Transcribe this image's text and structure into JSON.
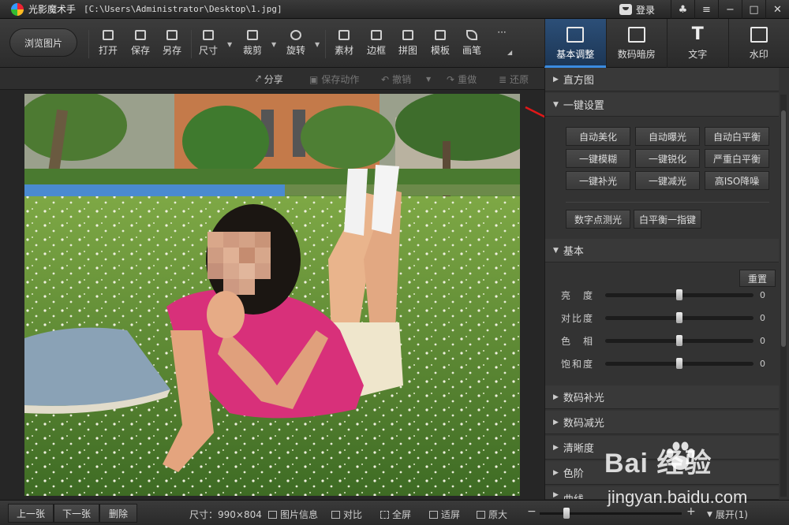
{
  "titlebar": {
    "app_name": "光影魔术手",
    "file_path": "[C:\\Users\\Administrator\\Desktop\\1.jpg]",
    "login": "登录",
    "buttons": [
      "skin-icon",
      "menu-icon",
      "minimize-icon",
      "maximize-icon",
      "close-icon"
    ]
  },
  "toolbar": {
    "browse": "浏览图片",
    "tools": [
      {
        "label": "打开",
        "icon": "open-icon"
      },
      {
        "label": "保存",
        "icon": "save-icon"
      },
      {
        "label": "另存",
        "icon": "save-as-icon"
      },
      {
        "label": "尺寸",
        "icon": "resize-icon"
      },
      {
        "label": "裁剪",
        "icon": "crop-icon"
      },
      {
        "label": "旋转",
        "icon": "rotate-icon"
      },
      {
        "label": "素材",
        "icon": "material-icon"
      },
      {
        "label": "边框",
        "icon": "frame-icon"
      },
      {
        "label": "拼图",
        "icon": "collage-icon"
      },
      {
        "label": "模板",
        "icon": "template-icon"
      },
      {
        "label": "画笔",
        "icon": "brush-icon"
      },
      {
        "label": "···",
        "icon": "more-icon"
      }
    ]
  },
  "mode_tabs": [
    {
      "label": "基本调整",
      "icon": "edit-icon",
      "active": true
    },
    {
      "label": "数码暗房",
      "icon": "camera-icon",
      "active": false
    },
    {
      "label": "文字",
      "icon": "text-icon",
      "active": false
    },
    {
      "label": "水印",
      "icon": "watermark-icon",
      "active": false
    }
  ],
  "subbar": {
    "share": "分享",
    "save_action": "保存动作",
    "undo": "撤销",
    "redo": "重做",
    "restore": "还原"
  },
  "panel": {
    "histogram": "直方图",
    "one_click": "一键设置",
    "one_click_buttons": [
      "自动美化",
      "自动曝光",
      "自动白平衡",
      "一键模糊",
      "一键锐化",
      "严重白平衡",
      "一键补光",
      "一键减光",
      "高ISO降噪"
    ],
    "extra_buttons": [
      "数字点测光",
      "白平衡一指键"
    ],
    "basic": "基本",
    "reset": "重置",
    "sliders": [
      {
        "label": "亮　度",
        "value": "0",
        "position": 0.5
      },
      {
        "label": "对比度",
        "value": "0",
        "position": 0.5
      },
      {
        "label": "色　相",
        "value": "0",
        "position": 0.5
      },
      {
        "label": "饱和度",
        "value": "0",
        "position": 0.5
      }
    ],
    "collapsed_sections": [
      "数码补光",
      "数码减光",
      "清晰度",
      "色阶",
      "曲线"
    ]
  },
  "bottombar": {
    "prev": "上一张",
    "next": "下一张",
    "delete": "删除",
    "size": "尺寸：990×804",
    "info": "图片信息",
    "compare": "对比",
    "fullscreen": "全屏",
    "fit": "适屏",
    "original": "原大",
    "zoom_minus": "−",
    "zoom_plus": "+",
    "expand": "展开(1)"
  },
  "watermark": {
    "brand": "Bai  经验",
    "url": "jingyan.baidu.com"
  },
  "colors": {
    "accent": "#3a8be0",
    "annotation": "#e01818"
  }
}
